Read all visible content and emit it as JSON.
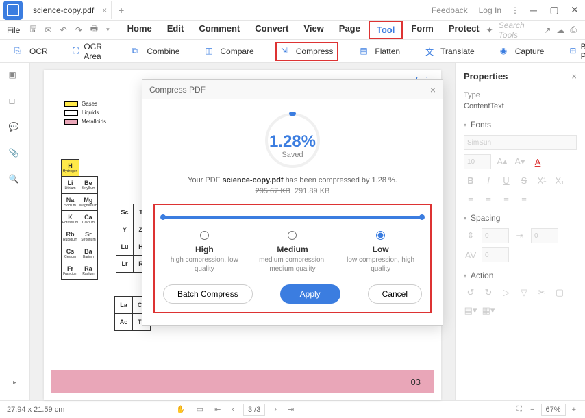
{
  "titlebar": {
    "filename": "science-copy.pdf",
    "feedback": "Feedback",
    "login": "Log In"
  },
  "menubar": {
    "file": "File",
    "items": [
      "Home",
      "Edit",
      "Comment",
      "Convert",
      "View",
      "Page",
      "Tool",
      "Form",
      "Protect"
    ],
    "search_placeholder": "Search Tools"
  },
  "toolbar": {
    "ocr": "OCR",
    "ocr_area": "OCR Area",
    "combine": "Combine",
    "compare": "Compare",
    "compress": "Compress",
    "flatten": "Flatten",
    "translate": "Translate",
    "capture": "Capture",
    "batch": "Batch Process"
  },
  "legend": {
    "gases": "Gases",
    "liquids": "Liquids",
    "metalloids": "Metalloids"
  },
  "page_number": "03",
  "props": {
    "title": "Properties",
    "type_label": "Type",
    "type_value": "ContentText",
    "fonts": "Fonts",
    "font_name": "SimSun",
    "font_size": "10",
    "spacing": "Spacing",
    "sp_val1": "0",
    "sp_val2": "0",
    "sp_val3": "0",
    "action": "Action"
  },
  "status": {
    "dims": "27.94 x 21.59 cm",
    "page_current": "3",
    "page_total": "/3",
    "zoom": "67%"
  },
  "dialog": {
    "title": "Compress PDF",
    "percent": "1.28%",
    "saved": "Saved",
    "msg_pre": "Your PDF ",
    "msg_file": "science-copy.pdf",
    "msg_post": " has been compressed by  1.28 %.",
    "old_size": "295.67 KB",
    "new_size": "291.89 KB",
    "opts": [
      {
        "name": "High",
        "desc": "high compression, low quality"
      },
      {
        "name": "Medium",
        "desc": "medium compression, medium quality"
      },
      {
        "name": "Low",
        "desc": "low compression, high quality"
      }
    ],
    "batch": "Batch Compress",
    "apply": "Apply",
    "cancel": "Cancel"
  }
}
